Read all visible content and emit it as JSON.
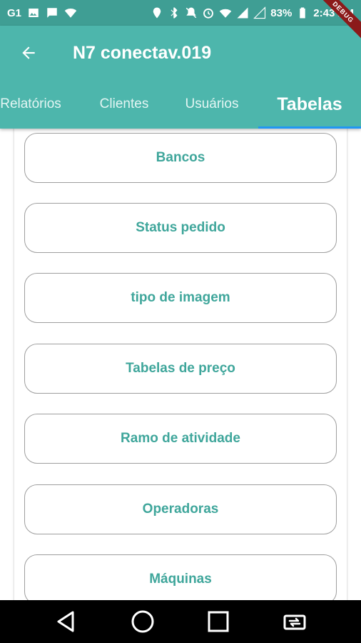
{
  "status_bar": {
    "battery_percent": "83%",
    "time": "2:43 PM"
  },
  "debug_banner": "DEBUG",
  "app_bar": {
    "title": "N7 conectav.019"
  },
  "tabs": [
    {
      "label": "Relatórios"
    },
    {
      "label": "Clientes"
    },
    {
      "label": "Usuários"
    },
    {
      "label": "Tabelas",
      "active": true
    }
  ],
  "items": [
    {
      "label": "Bancos"
    },
    {
      "label": "Status pedido"
    },
    {
      "label": "tipo de imagem"
    },
    {
      "label": "Tabelas de preço"
    },
    {
      "label": "Ramo de atividade"
    },
    {
      "label": "Operadoras"
    },
    {
      "label": "Máquinas"
    }
  ],
  "colors": {
    "app_bar": "#4db6ac",
    "status_bar": "#3f9e94",
    "accent_text": "#3fa69b",
    "tab_indicator": "#2196f3"
  }
}
